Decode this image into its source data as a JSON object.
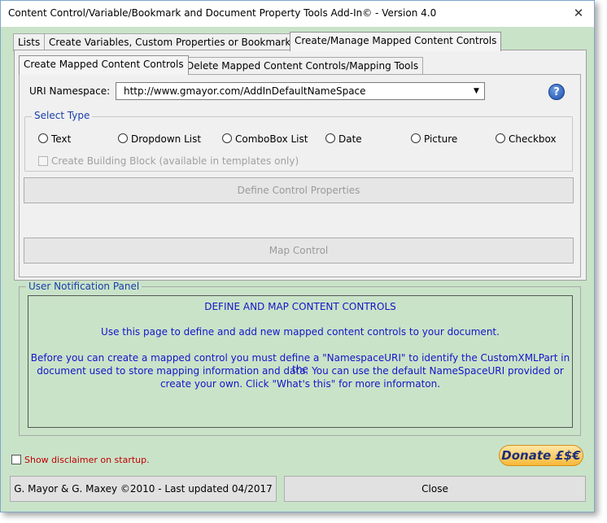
{
  "window": {
    "title": "Content Control/Variable/Bookmark and Document Property Tools Add-In© - Version 4.0",
    "close_glyph": "✕"
  },
  "tabs": [
    {
      "label": "Lists"
    },
    {
      "label": "Create Variables, Custom Properties or Bookmarks"
    },
    {
      "label": "Create/Manage Mapped Content Controls"
    }
  ],
  "subtabs": [
    {
      "label": "Create Mapped Content Controls"
    },
    {
      "label": "Delete Mapped Content Controls/Mapping Tools"
    }
  ],
  "uri": {
    "label": "URI Namespace:",
    "value": "http://www.gmayor.com/AddInDefaultNameSpace"
  },
  "help": {
    "glyph": "?"
  },
  "select_type": {
    "legend": "Select Type",
    "options": [
      {
        "label": "Text"
      },
      {
        "label": "Dropdown List"
      },
      {
        "label": "ComboBox List"
      },
      {
        "label": "Date"
      },
      {
        "label": "Picture"
      },
      {
        "label": "Checkbox"
      }
    ],
    "building_block": "Create Building Block (available in templates only)"
  },
  "buttons": {
    "define": "Define Control Properties",
    "map": "Map Control",
    "donate": "Donate £$€",
    "credit": "G. Mayor & G. Maxey ©2010 - Last updated 04/2017",
    "close": "Close"
  },
  "notification": {
    "legend": "User Notification Panel",
    "lines": [
      "DEFINE AND MAP CONTENT CONTROLS",
      "Use this page to define and add new mapped content controls to your document.",
      "Before you can create a mapped control you must define a \"NamespaceURI\" to identify the CustomXMLPart in the",
      "document used to store mapping information and data. You can use the default NameSpaceURI provided or",
      "create your own. Click \"What's this\" for more informaton."
    ]
  },
  "disclaimer": {
    "label": "Show disclaimer on startup."
  },
  "colors": {
    "dialog_bg": "#c9e3c9",
    "notify_text": "#1515c8",
    "legend_text": "#1a3ea8",
    "disclaimer_text": "#c00000"
  }
}
